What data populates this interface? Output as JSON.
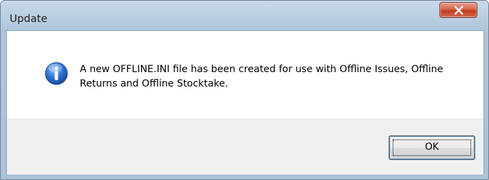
{
  "window": {
    "title": "Update",
    "close_tooltip_icon": "close-x-icon"
  },
  "dialog": {
    "icon": "information-icon",
    "message": "A new OFFLINE.INI file has been created for use with Offline Issues, Offline Returns and Offline Stocktake."
  },
  "buttons": {
    "ok_label": "OK"
  },
  "colors": {
    "title_bar": "#b9cde2",
    "close_button": "#c94a2c",
    "info_icon": "#1f5fb9",
    "button_area": "#f0f0f0"
  }
}
